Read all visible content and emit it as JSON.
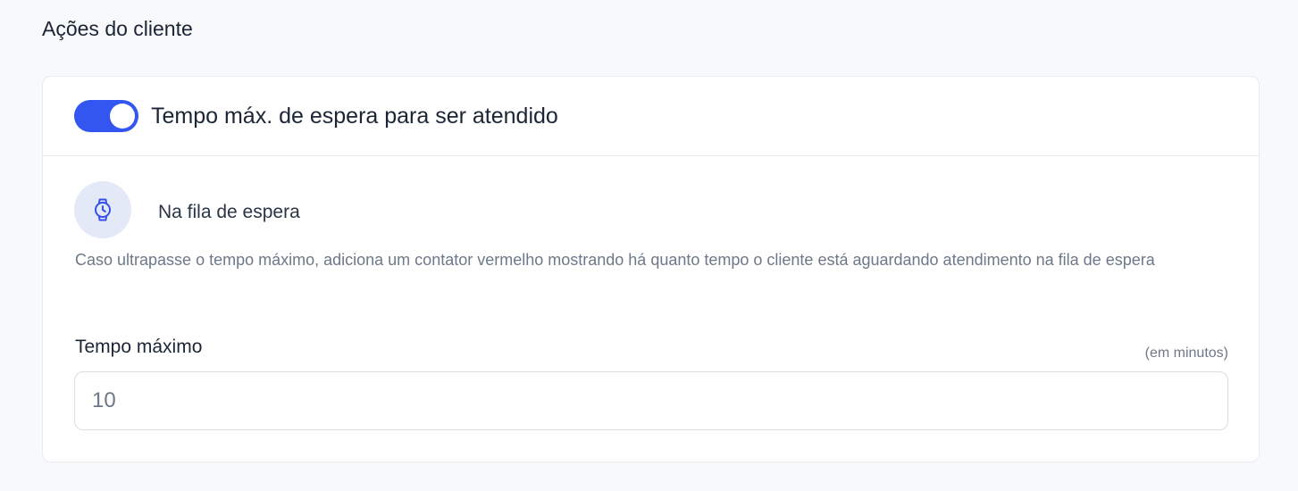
{
  "section": {
    "title": "Ações do cliente"
  },
  "card": {
    "toggle": {
      "enabled": true,
      "color": "#3355f0"
    },
    "header_label": "Tempo máx. de espera para ser atendido",
    "queue_item": {
      "icon": "stopwatch-icon",
      "label": "Na fila de espera"
    },
    "description": "Caso ultrapasse o tempo máximo, adiciona um contator vermelho mostrando há quanto tempo o cliente está aguardando atendimento na fila de espera",
    "field": {
      "label": "Tempo máximo",
      "hint": "(em minutos)",
      "value": "10"
    }
  }
}
